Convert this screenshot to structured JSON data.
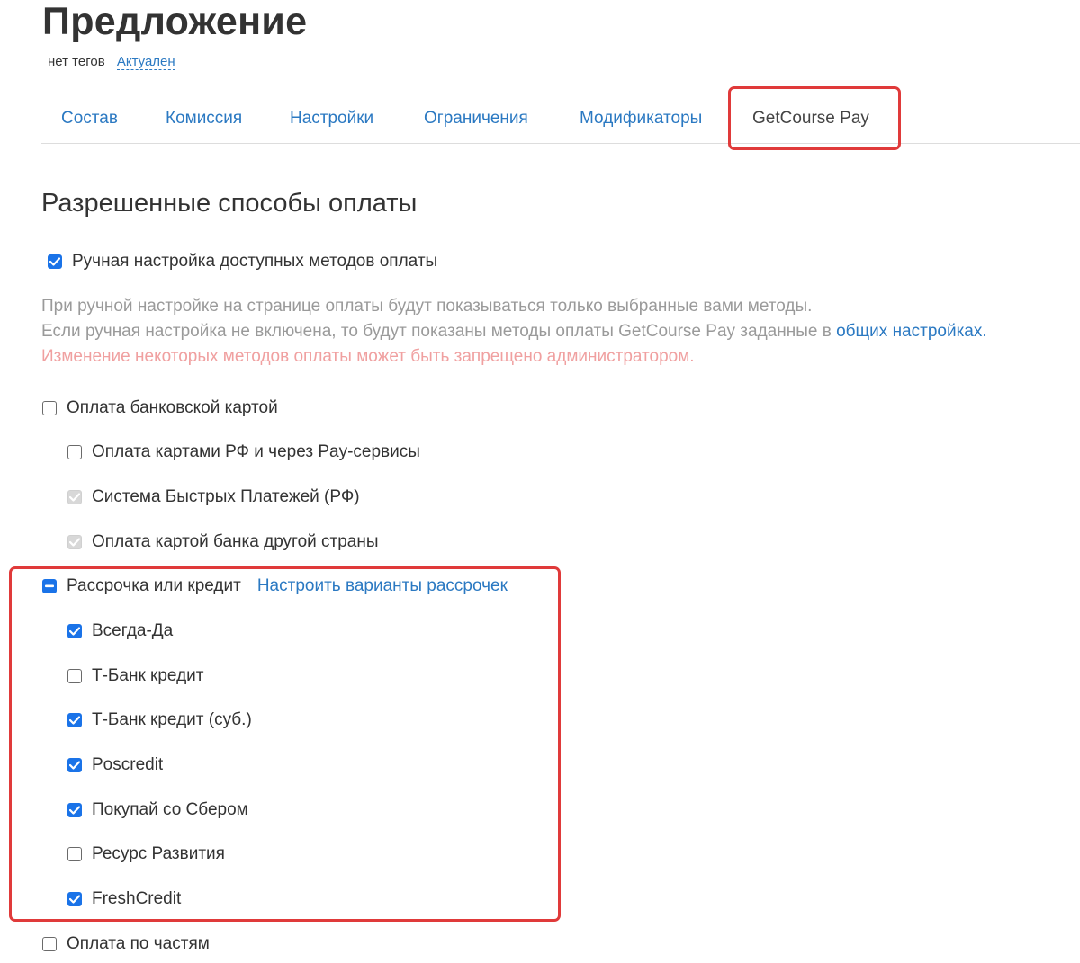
{
  "header": {
    "title": "Предложение",
    "tags_label": "нет тегов",
    "status_link": "Актуален"
  },
  "tabs": [
    {
      "label": "Состав"
    },
    {
      "label": "Комиссия"
    },
    {
      "label": "Настройки"
    },
    {
      "label": "Ограничения"
    },
    {
      "label": "Модификаторы"
    },
    {
      "label": "GetCourse Pay"
    }
  ],
  "section": {
    "heading": "Разрешенные способы оплаты",
    "manual_setting_label": "Ручная настройка доступных методов оплаты",
    "help_line1": "При ручной настройке на странице оплаты будут показываться только выбранные вами методы.",
    "help_line2_prefix": "Если ручная настройка не включена, то будут показаны методы оплаты GetCourse Pay заданные в ",
    "help_line2_link": "общих настройках.",
    "help_warning": "Изменение некоторых методов оплаты может быть запрещено администратором."
  },
  "methods": {
    "bank_card": {
      "label": "Оплата банковской картой",
      "items": [
        {
          "label": "Оплата картами РФ и через Pay-сервисы",
          "state": "unchecked"
        },
        {
          "label": "Система Быстрых Платежей (РФ)",
          "state": "disabled-checked"
        },
        {
          "label": "Оплата картой банка другой страны",
          "state": "disabled-checked"
        }
      ]
    },
    "installment": {
      "label": "Рассрочка или кредит",
      "link": "Настроить варианты рассрочек",
      "state": "indeterminate",
      "items": [
        {
          "label": "Всегда-Да",
          "state": "checked"
        },
        {
          "label": "Т-Банк кредит",
          "state": "unchecked"
        },
        {
          "label": "Т-Банк кредит (суб.)",
          "state": "checked"
        },
        {
          "label": "Poscredit",
          "state": "checked"
        },
        {
          "label": "Покупай со Сбером",
          "state": "checked"
        },
        {
          "label": "Ресурс Развития",
          "state": "unchecked"
        },
        {
          "label": "FreshCredit",
          "state": "checked"
        }
      ]
    },
    "parts": {
      "label": "Оплата по частям",
      "state": "unchecked"
    }
  },
  "colors": {
    "accent": "#1a73e8",
    "link": "#2b79c2",
    "highlight": "#e03a3a",
    "warning": "#f0a0a0"
  }
}
